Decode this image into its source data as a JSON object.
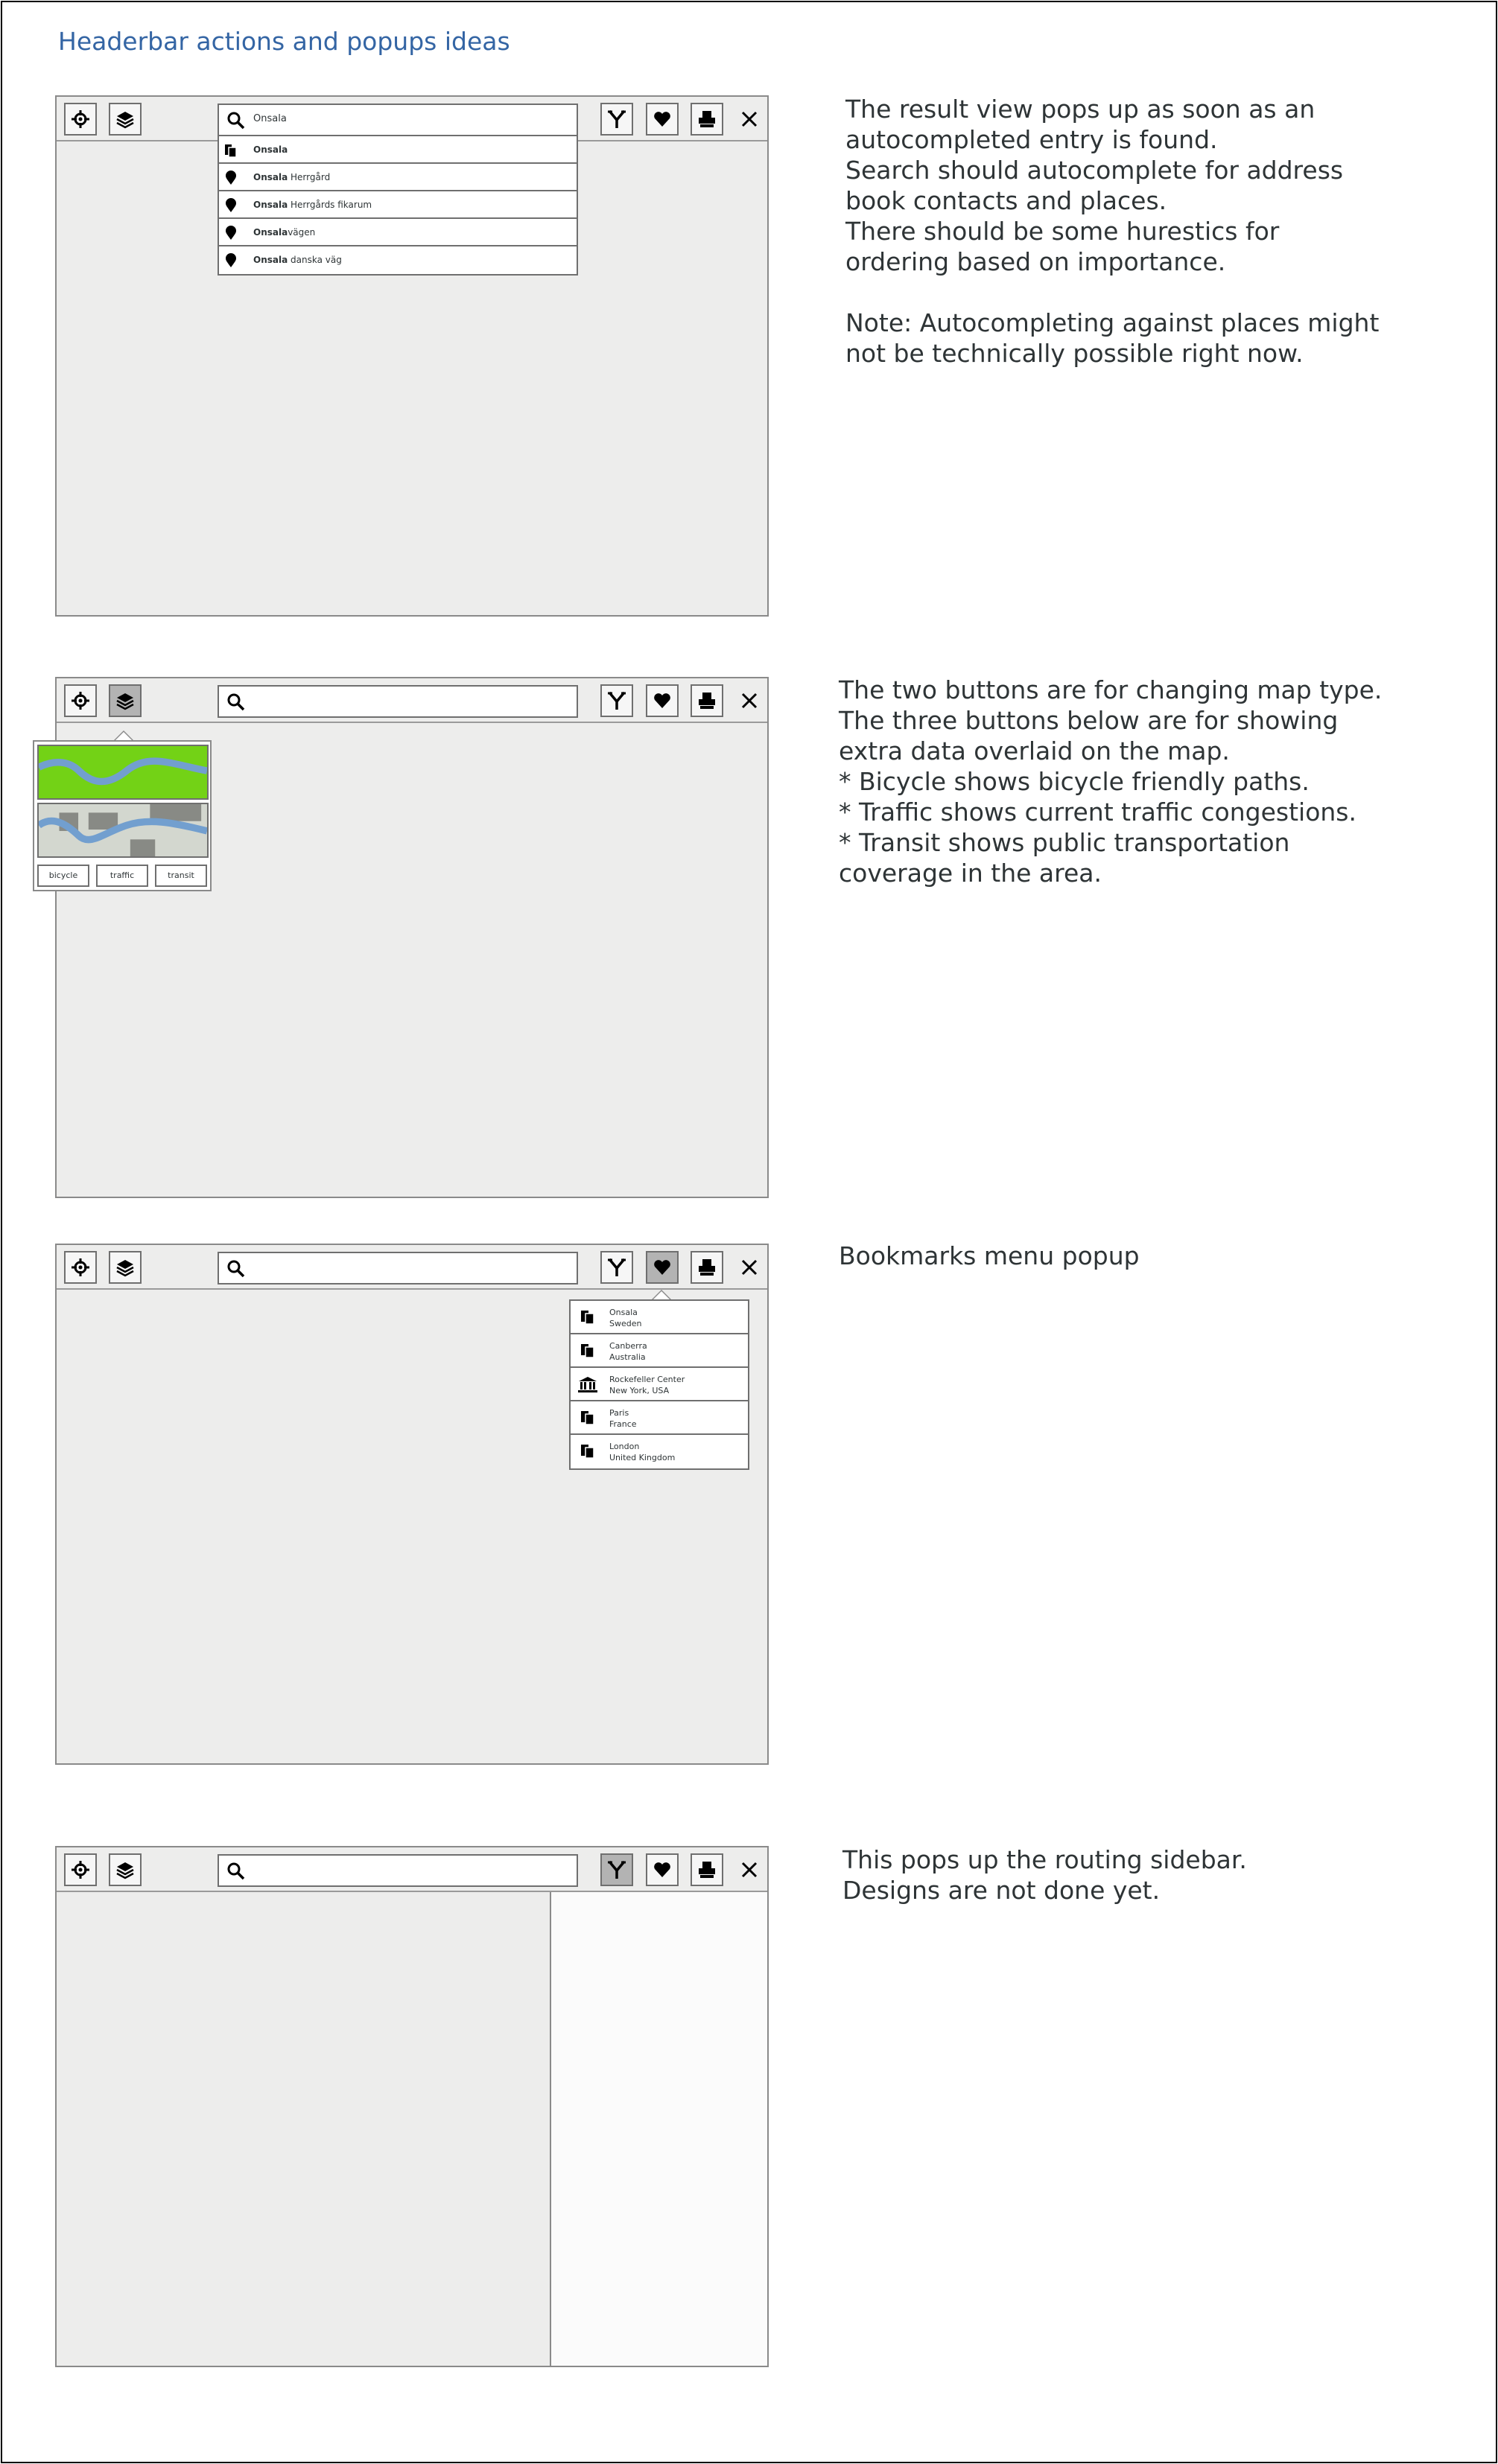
{
  "page_title": "Headerbar actions and popups ideas",
  "search_query": "Onsala",
  "autocomplete": [
    {
      "icon": "contact-icon",
      "bold": "Onsala",
      "rest": ""
    },
    {
      "icon": "place-pin-icon",
      "bold": "Onsala",
      "rest": " Herrgård"
    },
    {
      "icon": "place-pin-icon",
      "bold": "Onsala",
      "rest": " Herrgårds fikarum"
    },
    {
      "icon": "place-pin-icon",
      "bold": "Onsala",
      "rest": "vägen"
    },
    {
      "icon": "place-pin-icon",
      "bold": "Onsala",
      "rest": " danska väg"
    }
  ],
  "notes": {
    "autocomplete": "The result view pops up as soon as an\nautocompleted entry is found.\nSearch should autocomplete for address\nbook contacts and places.\nThere should be some hurestics for\nordering based on importance.\n\nNote: Autocompleting against places might\nnot be technically possible right now.",
    "layers": "The two buttons are for changing map type.\nThe three buttons below are for showing\nextra data overlaid on the map.\n* Bicycle shows bicycle friendly paths.\n* Traffic shows current traffic congestions.\n* Transit shows public transportation\ncoverage in the area.",
    "bookmarks": "Bookmarks menu popup",
    "routing": "This pops up the routing sidebar.\nDesigns are not done yet."
  },
  "layer_overlays": [
    "bicycle",
    "traffic",
    "transit"
  ],
  "bookmarks": [
    {
      "icon": "contact-icon",
      "name": "Onsala",
      "detail": "Sweden"
    },
    {
      "icon": "contact-icon",
      "name": "Canberra",
      "detail": "Australia"
    },
    {
      "icon": "landmark-icon",
      "name": "Rockefeller Center",
      "detail": "New York, USA"
    },
    {
      "icon": "contact-icon",
      "name": "Paris",
      "detail": "France"
    },
    {
      "icon": "contact-icon",
      "name": "London",
      "detail": "United Kingdom"
    }
  ],
  "colors": {
    "title": "#3465a4",
    "map_bg": "#ededec",
    "satellite_green": "#73d216",
    "river_blue": "#729fcf",
    "active_button": "#b3b3b3"
  },
  "icons": {
    "locate": "crosshair-icon",
    "layers": "layers-icon",
    "route": "route-icon",
    "bookmarks": "heart-icon",
    "print": "print-icon",
    "close": "close-icon",
    "search": "search-icon"
  }
}
